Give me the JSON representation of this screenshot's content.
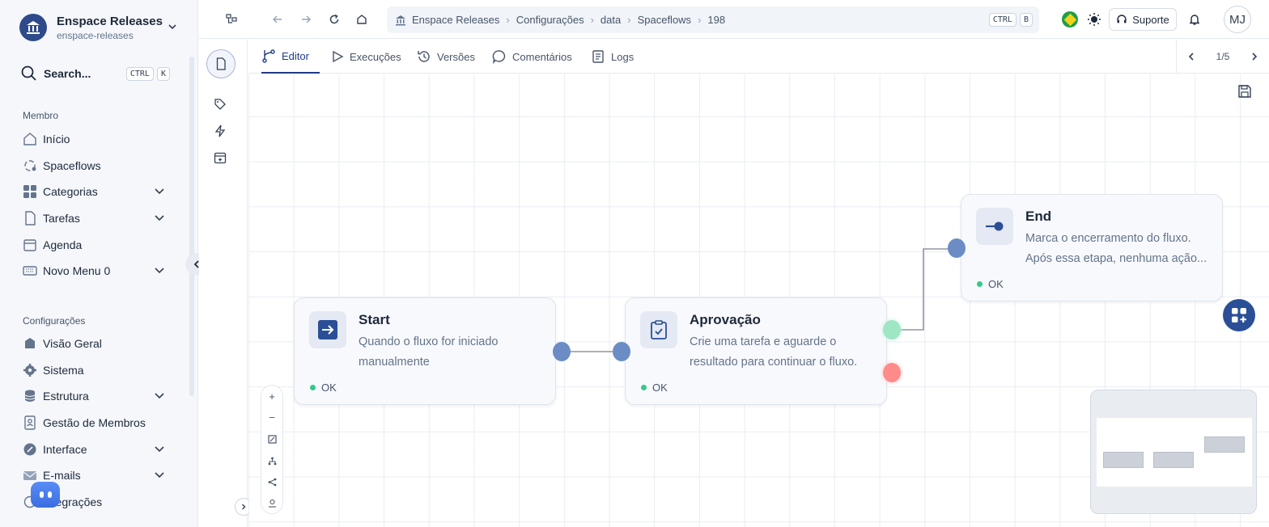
{
  "workspace": {
    "name": "Enspace Releases",
    "slug": "enspace-releases"
  },
  "search": {
    "label": "Search...",
    "kbd": [
      "CTRL",
      "K"
    ]
  },
  "sidebar": {
    "member_section": "Membro",
    "member_items": [
      {
        "label": "Início",
        "icon": "home-icon"
      },
      {
        "label": "Spaceflows",
        "icon": "flow-icon"
      },
      {
        "label": "Categorias",
        "icon": "grid-icon",
        "expandable": true
      },
      {
        "label": "Tarefas",
        "icon": "document-icon",
        "expandable": true
      },
      {
        "label": "Agenda",
        "icon": "calendar-icon"
      },
      {
        "label": "Novo Menu 0",
        "icon": "keyboard-icon",
        "expandable": true
      }
    ],
    "config_section": "Configurações",
    "config_items": [
      {
        "label": "Visão Geral",
        "icon": "overview-icon"
      },
      {
        "label": "Sistema",
        "icon": "gear-icon"
      },
      {
        "label": "Estrutura",
        "icon": "database-icon",
        "expandable": true
      },
      {
        "label": "Gestão de Membros",
        "icon": "member-card-icon"
      },
      {
        "label": "Interface",
        "icon": "palette-icon",
        "expandable": true
      },
      {
        "label": "E-mails",
        "icon": "mail-icon",
        "expandable": true
      },
      {
        "label": "Integrações",
        "icon": "integration-icon"
      }
    ]
  },
  "breadcrumbs": [
    "Enspace Releases",
    "Configurações",
    "data",
    "Spaceflows",
    "198"
  ],
  "breadcrumb_kbd": [
    "CTRL",
    "B"
  ],
  "topbar": {
    "support_label": "Suporte",
    "avatar_initials": "MJ"
  },
  "tabs": [
    {
      "label": "Editor",
      "icon": "branch-icon",
      "active": true
    },
    {
      "label": "Execuções",
      "icon": "play-icon"
    },
    {
      "label": "Versões",
      "icon": "history-icon"
    },
    {
      "label": "Comentários",
      "icon": "comment-icon"
    },
    {
      "label": "Logs",
      "icon": "logs-icon"
    }
  ],
  "pager": {
    "text": "1/5"
  },
  "nodes": {
    "start": {
      "title": "Start",
      "description": "Quando o fluxo for iniciado manualmente",
      "status": "OK"
    },
    "approval": {
      "title": "Aprovação",
      "description": "Crie uma tarefa e aguarde o resultado para continuar o fluxo.",
      "status": "OK"
    },
    "end": {
      "title": "End",
      "description": "Marca o encerramento do fluxo. Após essa etapa, nenhuma ação...",
      "status": "OK"
    }
  },
  "zoom_controls": {
    "zoom_in": "+",
    "zoom_out": "−"
  },
  "colors": {
    "accent": "#2a4f96",
    "handle": "#6b8cc4",
    "success_handle": "#9ee6c4",
    "fail_handle": "#ff8a8a",
    "status_ok": "#34c98a"
  }
}
